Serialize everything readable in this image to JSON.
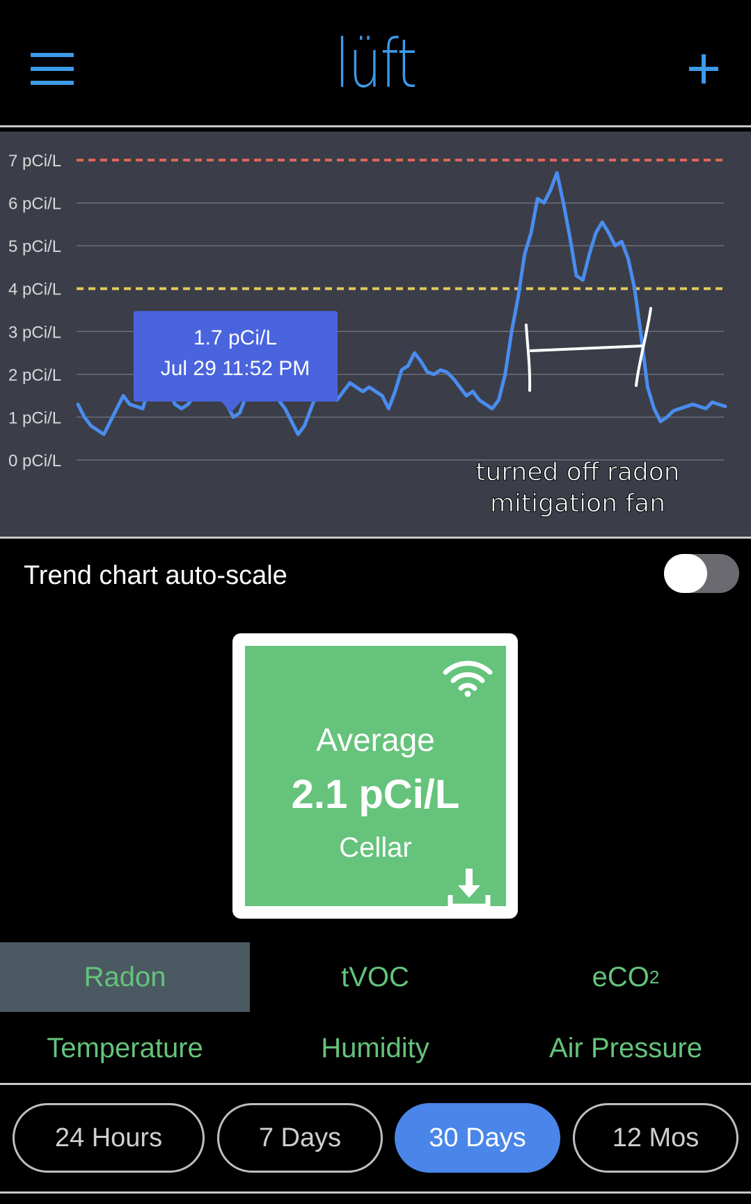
{
  "header": {
    "logo": "lüft",
    "menu_icon": "hamburger-icon",
    "add_icon": "plus-icon"
  },
  "colors": {
    "accent": "#3d9ae8",
    "chart_bg": "#3b3e48",
    "series": "#4a8cf0",
    "danger_threshold": "#e0655a",
    "warning_threshold": "#e2c95a",
    "card_green": "#65c37b",
    "metric_text": "#65c37b",
    "pill_active": "#4a86ea"
  },
  "chart_data": {
    "type": "line",
    "ylabel": "",
    "xlabel": "",
    "ylim": [
      0,
      7
    ],
    "y_ticks": [
      "0 pCi/L",
      "1 pCi/L",
      "2 pCi/L",
      "3 pCi/L",
      "4 pCi/L",
      "5 pCi/L",
      "6 pCi/L",
      "7 pCi/L"
    ],
    "grid": true,
    "thresholds": [
      {
        "value": 7,
        "color": "#e0655a",
        "style": "dashed"
      },
      {
        "value": 4,
        "color": "#e2c95a",
        "style": "dashed"
      }
    ],
    "series": [
      {
        "x": [
          0,
          1,
          2,
          3,
          4,
          5,
          6,
          7,
          8,
          9,
          10,
          11,
          12,
          13,
          14,
          15,
          16,
          17,
          18,
          19,
          20,
          21,
          22,
          23,
          24,
          25,
          26,
          27,
          28,
          29,
          30,
          31,
          32,
          33,
          34,
          35,
          36,
          37,
          38,
          39,
          40,
          41,
          42,
          43,
          44,
          45,
          46,
          47,
          48,
          49,
          50,
          51,
          52,
          53,
          54,
          55,
          56,
          57,
          58,
          59,
          60,
          61,
          62,
          63,
          64,
          65,
          66,
          67,
          68,
          69,
          70,
          71,
          72,
          73,
          74,
          75,
          76,
          77,
          78,
          79,
          80,
          81,
          82,
          83,
          84,
          85,
          86,
          87,
          88,
          89,
          90,
          91,
          92,
          93,
          94,
          95,
          96,
          97,
          98,
          99,
          100
        ],
        "values": [
          1.3,
          1.0,
          0.8,
          0.7,
          0.6,
          0.9,
          1.2,
          1.5,
          1.3,
          1.25,
          1.2,
          1.7,
          1.9,
          1.85,
          1.6,
          1.3,
          1.2,
          1.3,
          1.5,
          1.6,
          1.9,
          2.0,
          1.7,
          1.3,
          1.0,
          1.1,
          1.5,
          1.8,
          1.85,
          1.6,
          1.5,
          1.4,
          1.2,
          0.9,
          0.6,
          0.8,
          1.2,
          1.6,
          1.8,
          1.5,
          1.4,
          1.6,
          1.8,
          1.7,
          1.6,
          1.7,
          1.6,
          1.5,
          1.2,
          1.6,
          2.1,
          2.2,
          2.5,
          2.3,
          2.05,
          2.0,
          2.1,
          2.05,
          1.9,
          1.7,
          1.5,
          1.6,
          1.4,
          1.3,
          1.2,
          1.4,
          2.0,
          3.0,
          3.8,
          4.8,
          5.3,
          6.1,
          6.0,
          6.3,
          6.7,
          6.0,
          5.2,
          4.3,
          4.2,
          4.8,
          5.3,
          5.55,
          5.3,
          5.0,
          5.1,
          4.7,
          4.0,
          2.9,
          1.7,
          1.2,
          0.9,
          1.0,
          1.15,
          1.2,
          1.25,
          1.3,
          1.25,
          1.2,
          1.35,
          1.3,
          1.25
        ]
      }
    ],
    "tooltip": {
      "value": "1.7 pCi/L",
      "time": "Jul 29 11:52 PM"
    },
    "annotation": {
      "line1": "turned off radon",
      "line2": "mitigation fan"
    }
  },
  "autoscale": {
    "label": "Trend chart auto-scale",
    "enabled": false
  },
  "card": {
    "title": "Average",
    "value": "2.1 pCi/L",
    "location": "Cellar",
    "status_icon": "wifi-icon",
    "action_icon": "download-icon"
  },
  "metrics": [
    {
      "label": "Radon",
      "active": true
    },
    {
      "label": "tVOC",
      "active": false
    },
    {
      "label": "eCO",
      "sub": "2",
      "active": false
    },
    {
      "label": "Temperature",
      "active": false
    },
    {
      "label": "Humidity",
      "active": false
    },
    {
      "label": "Air Pressure",
      "active": false
    }
  ],
  "ranges": [
    {
      "label": "24 Hours",
      "active": false
    },
    {
      "label": "7 Days",
      "active": false
    },
    {
      "label": "30 Days",
      "active": true
    },
    {
      "label": "12 Mos",
      "active": false
    }
  ]
}
